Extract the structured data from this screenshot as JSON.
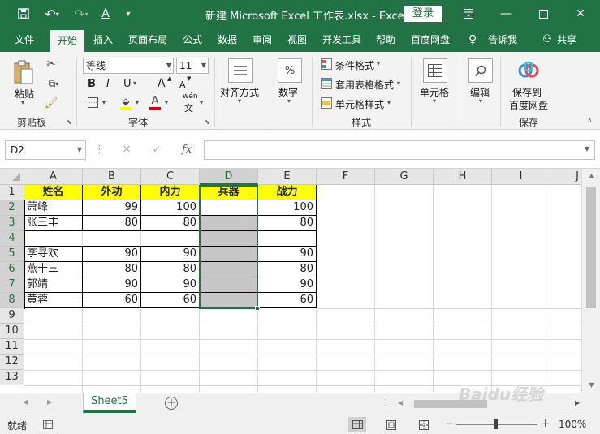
{
  "window": {
    "title": "新建 Microsoft Excel 工作表.xlsx  -  Excel",
    "signin_label": "登录"
  },
  "menu": {
    "tabs": [
      "文件",
      "开始",
      "插入",
      "页面布局",
      "公式",
      "数据",
      "审阅",
      "视图",
      "开发工具",
      "帮助",
      "百度网盘"
    ],
    "tell_me": "告诉我",
    "share": "共享"
  },
  "ribbon": {
    "clipboard": {
      "paste_label": "粘贴",
      "group_label": "剪贴板"
    },
    "font": {
      "font_name": "等线",
      "font_size": "11",
      "bold": "B",
      "italic": "I",
      "underline": "U",
      "grow": "A",
      "shrink": "A",
      "font_color": "A",
      "highlight": "ab",
      "phonetic": "wén",
      "group_label": "字体"
    },
    "alignment": {
      "label": "对齐方式"
    },
    "number": {
      "label": "数字",
      "symbol": "%"
    },
    "styles": {
      "conditional": "条件格式",
      "table": "套用表格格式",
      "cell_styles": "单元格样式",
      "group_label": "样式"
    },
    "cells": {
      "label": "单元格"
    },
    "editing": {
      "label": "编辑"
    },
    "save": {
      "line1": "保存到",
      "line2": "百度网盘",
      "group_label": "保存"
    }
  },
  "formula_bar": {
    "name_box": "D2",
    "fx": "fx",
    "value": ""
  },
  "sheet": {
    "columns": [
      "A",
      "B",
      "C",
      "D",
      "E",
      "F",
      "G",
      "H",
      "I",
      "J"
    ],
    "rows": [
      "1",
      "2",
      "3",
      "4",
      "5",
      "6",
      "7",
      "8",
      "9",
      "10",
      "11",
      "12",
      "13"
    ],
    "selected_column": "D",
    "headers": [
      "姓名",
      "外功",
      "内力",
      "兵器",
      "战力"
    ],
    "data": [
      [
        "萧峰",
        "99",
        "100",
        "",
        "100"
      ],
      [
        "张三丰",
        "80",
        "80",
        "",
        "80"
      ],
      [
        "",
        "",
        "",
        "",
        ""
      ],
      [
        "李寻欢",
        "90",
        "90",
        "",
        "90"
      ],
      [
        "燕十三",
        "80",
        "80",
        "",
        "80"
      ],
      [
        "郭靖",
        "90",
        "90",
        "",
        "90"
      ],
      [
        "黄蓉",
        "60",
        "60",
        "",
        "60"
      ]
    ]
  },
  "sheet_tabs": {
    "active": "Sheet5",
    "add": "+"
  },
  "status": {
    "mode": "就绪",
    "zoom": "100%"
  },
  "watermark": "Baidu经验"
}
